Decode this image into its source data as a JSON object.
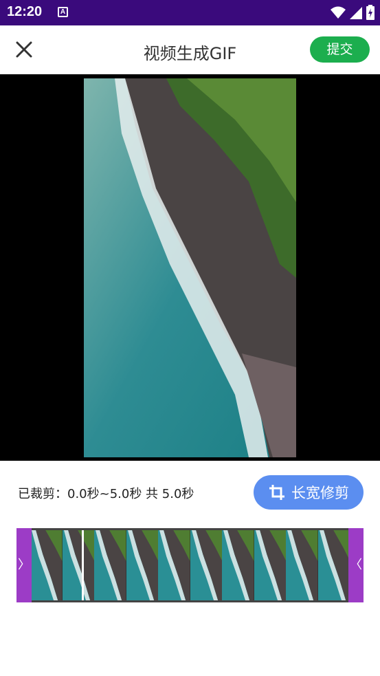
{
  "status_bar": {
    "time": "12:20",
    "notification_icon_letter": "A",
    "icons": [
      "wifi-icon",
      "signal-icon",
      "battery-charging-icon"
    ]
  },
  "header": {
    "title": "视频生成GIF",
    "close_icon": "close-icon",
    "submit_label": "提交"
  },
  "trim": {
    "info_text": "已裁剪：0.0秒~5.0秒  共 5.0秒",
    "start_seconds": 0.0,
    "end_seconds": 5.0,
    "total_seconds": 5.0,
    "crop_label": "长宽修剪",
    "crop_icon": "crop-icon"
  },
  "timeline": {
    "left_handle": "〉",
    "right_handle": "〈",
    "thumbnail_count": 10
  },
  "colors": {
    "status_bar": "#3a0a7c",
    "submit": "#1cae4e",
    "crop_button": "#5b8ef0",
    "handles": "#9c3cc6"
  }
}
